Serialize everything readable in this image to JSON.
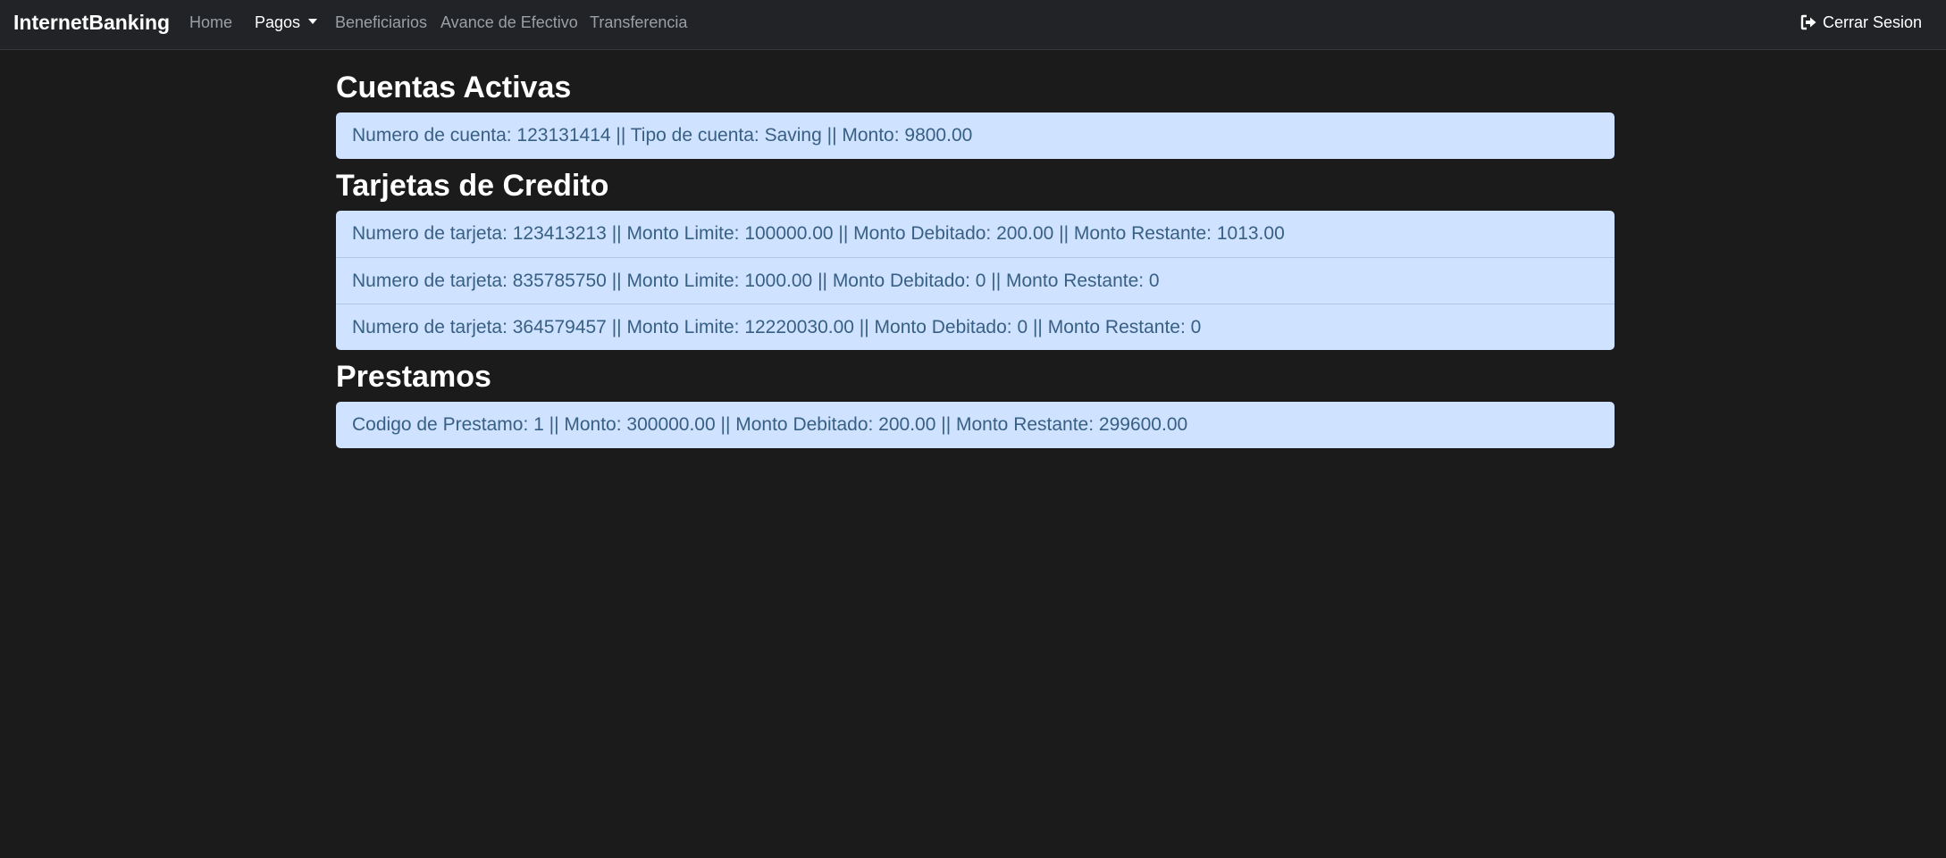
{
  "navbar": {
    "brand": "InternetBanking",
    "links": [
      {
        "label": "Home"
      },
      {
        "label": "Pagos"
      },
      {
        "label": "Beneficiarios"
      },
      {
        "label": "Avance de Efectivo"
      },
      {
        "label": "Transferencia"
      }
    ],
    "logout_label": "Cerrar Sesion",
    "logout_icon": "sign-out-icon"
  },
  "sections": {
    "accounts": {
      "title": "Cuentas Activas",
      "items": [
        "Numero de cuenta: 123131414 || Tipo de cuenta: Saving || Monto: 9800.00"
      ]
    },
    "cards": {
      "title": "Tarjetas de Credito",
      "items": [
        "Numero de tarjeta: 123413213 || Monto Limite: 100000.00 || Monto Debitado: 200.00 || Monto Restante: 1013.00",
        "Numero de tarjeta: 835785750 || Monto Limite: 1000.00 || Monto Debitado: 0 || Monto Restante: 0",
        "Numero de tarjeta: 364579457 || Monto Limite: 12220030.00 || Monto Debitado: 0 || Monto Restante: 0"
      ]
    },
    "loans": {
      "title": "Prestamos",
      "items": [
        "Codigo de Prestamo: 1 || Monto: 300000.00 || Monto Debitado: 200.00 || Monto Restante: 299600.00"
      ]
    }
  },
  "colors": {
    "background": "#1b1b1c",
    "navbar": "#212326",
    "list_background": "#cfe2ff",
    "list_text": "#385f84"
  }
}
